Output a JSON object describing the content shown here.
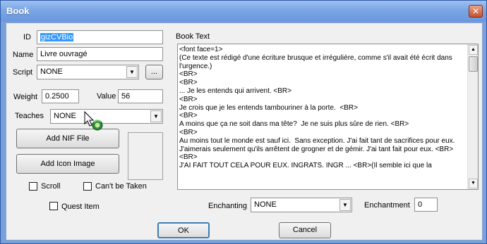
{
  "window": {
    "title": "Book",
    "close_glyph": "✕"
  },
  "form": {
    "id_label": "ID",
    "id_value": "gizCVBio",
    "name_label": "Name",
    "name_value": "Livre ouvragé",
    "script_label": "Script",
    "script_value": "NONE",
    "script_browse_label": "...",
    "weight_label": "Weight",
    "weight_value": "0.2500",
    "value_label": "Value",
    "value_value": "56",
    "teaches_label": "Teaches",
    "teaches_value": "NONE",
    "add_nif_label": "Add NIF File",
    "add_icon_label": "Add Icon Image",
    "scroll_label": "Scroll",
    "cant_be_taken_label": "Can't be Taken",
    "quest_item_label": "Quest Item",
    "book_text_label": "Book Text",
    "book_text": "<font face=1>\n(Ce texte est rédigé d'une écriture brusque et irrégulière, comme s'il avait été écrit dans l'urgence.)\n<BR>\n<BR>\n... Je les entends qui arrivent. <BR>\n<BR>\nJe crois que je les entends tambouriner à la porte.  <BR>\n<BR>\nA moins que ça ne soit dans ma tête?  Je ne suis plus sûre de rien. <BR>\n<BR>\nAu moins tout le monde est sauf ici.  Sans exception. J'ai fait tant de sacrifices pour eux. J'aimerais seulement qu'ils arrêtent de grogner et de gémir. J'ai tant fait pour eux. <BR>\n<BR>\nJ'AI FAIT TOUT CELA POUR EUX. INGRATS. INGR ... <BR>(Il semble ici que la",
    "enchanting_label": "Enchanting",
    "enchanting_value": "NONE",
    "enchantment_label": "Enchantment",
    "enchantment_value": "0",
    "ok_label": "OK",
    "cancel_label": "Cancel"
  },
  "icons": {
    "close": "close-icon",
    "dropdown": "chevron-down-icon",
    "scroll_up": "scroll-up-arrow-icon",
    "scroll_down": "scroll-down-arrow-icon",
    "cursor": "busy-cursor-icon"
  }
}
